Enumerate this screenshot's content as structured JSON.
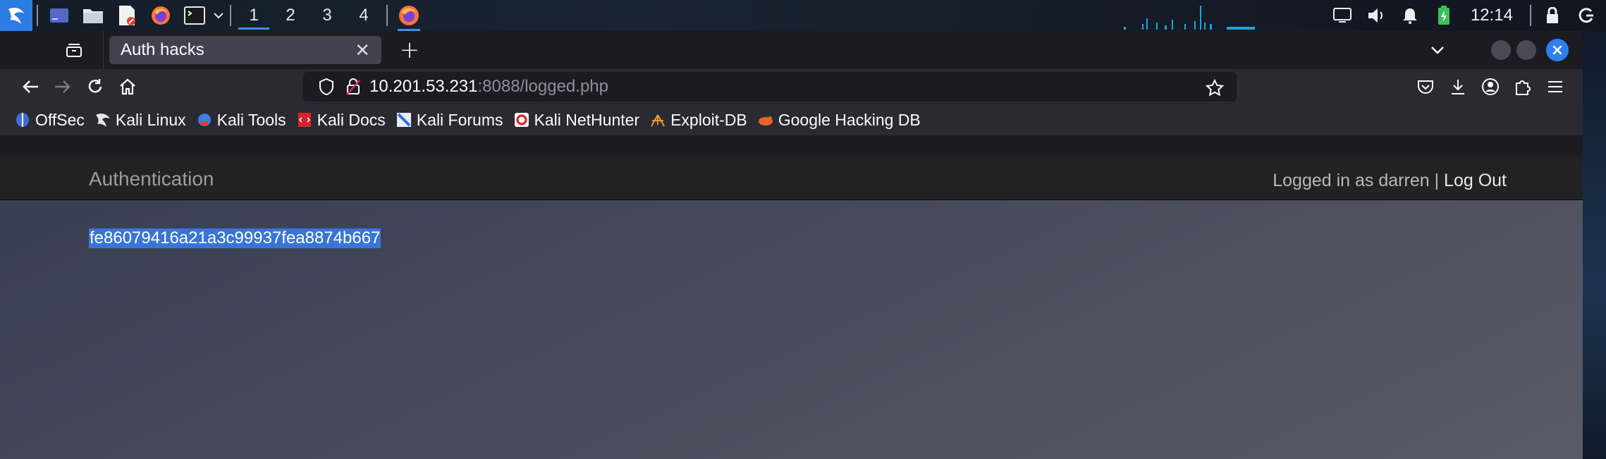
{
  "taskbar": {
    "workspaces": [
      "1",
      "2",
      "3",
      "4"
    ],
    "active_workspace": "1",
    "clock": "12:14",
    "accent": "#2b7de1"
  },
  "browser": {
    "tab_title": "Auth hacks",
    "url_host": "10.201.53.231",
    "url_rest": ":8088/logged.php",
    "bookmarks": [
      {
        "label": "OffSec",
        "icon": "offsec-icon"
      },
      {
        "label": "Kali Linux",
        "icon": "kali-dragon-icon"
      },
      {
        "label": "Kali Tools",
        "icon": "kali-tools-icon"
      },
      {
        "label": "Kali Docs",
        "icon": "kali-docs-icon"
      },
      {
        "label": "Kali Forums",
        "icon": "kali-forums-icon"
      },
      {
        "label": "Kali NetHunter",
        "icon": "nethunter-icon"
      },
      {
        "label": "Exploit-DB",
        "icon": "exploit-db-icon"
      },
      {
        "label": "Google Hacking DB",
        "icon": "ghdb-icon"
      }
    ]
  },
  "page": {
    "brand": "Authentication",
    "logged_in_text": "Logged in as darren",
    "separator": "|",
    "logout_label": "Log Out",
    "hash": "fe86079416a21a3c99937fea8874b667"
  }
}
